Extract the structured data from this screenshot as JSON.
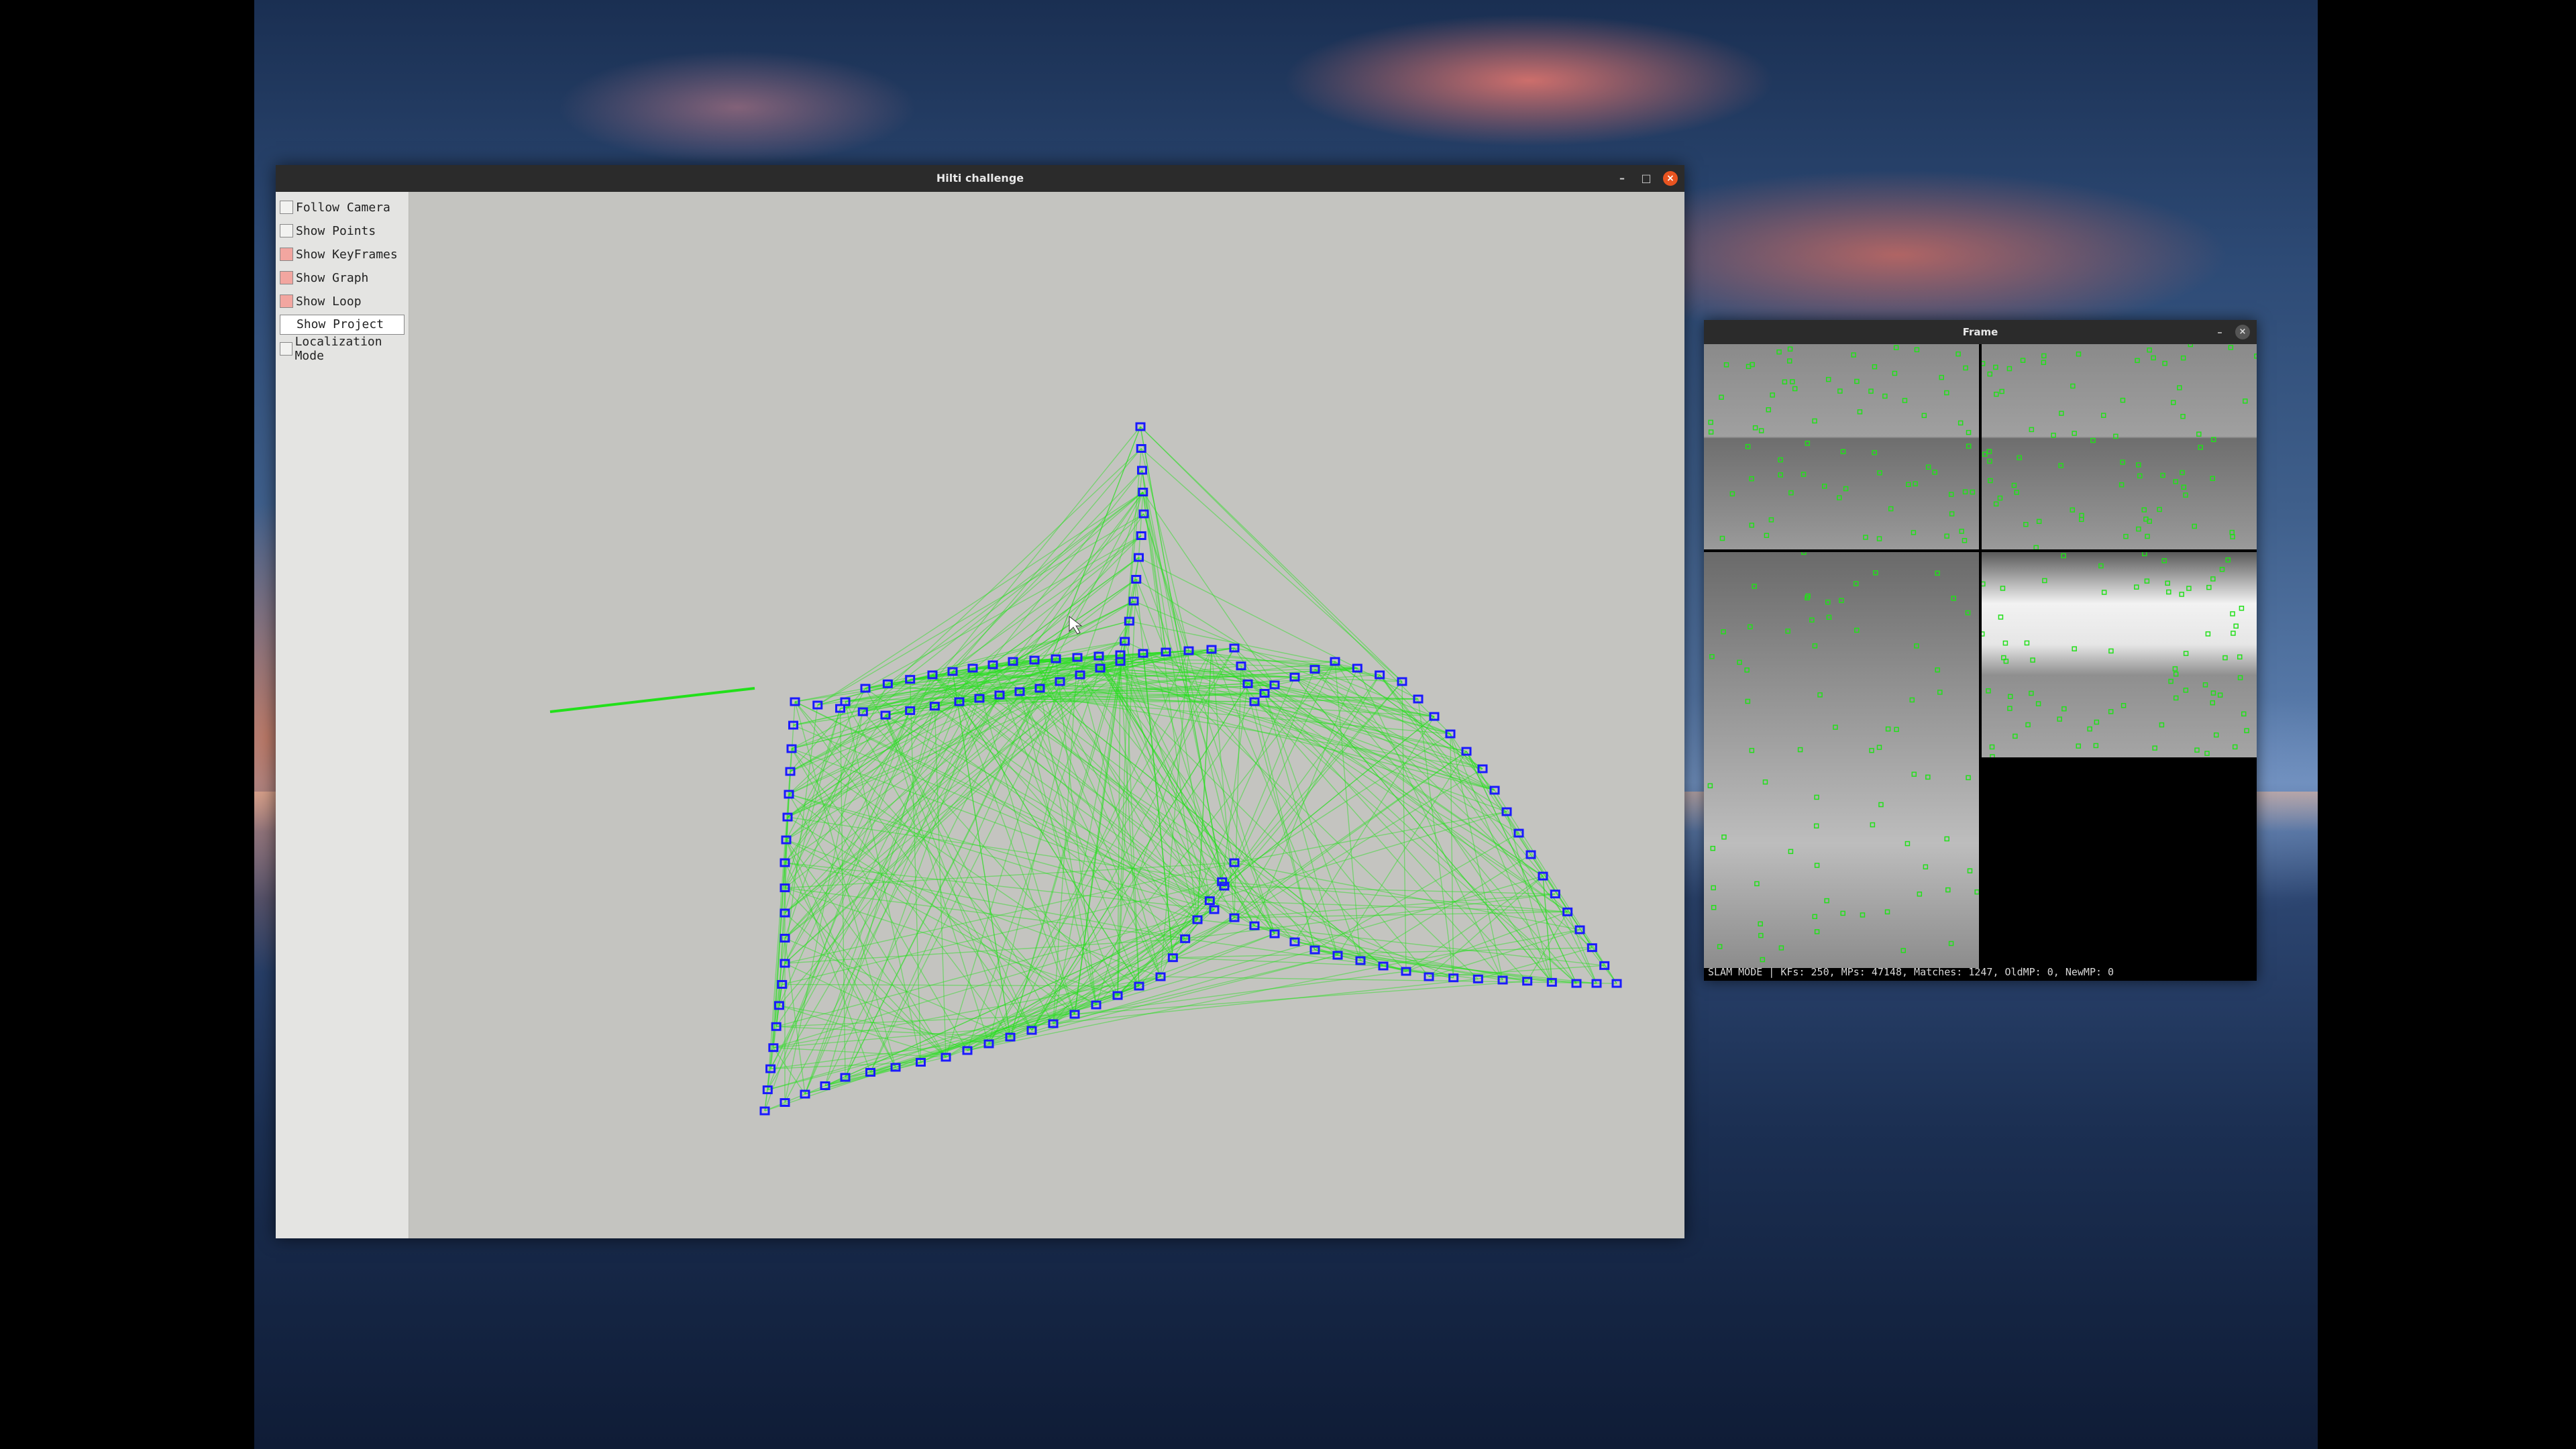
{
  "main_window": {
    "title": "Hilti challenge",
    "controls": {
      "minimize": "–",
      "maximize": "□",
      "close": "×"
    },
    "panel": {
      "items": [
        {
          "label": "Follow Camera",
          "checked": false
        },
        {
          "label": "Show Points",
          "checked": false
        },
        {
          "label": "Show KeyFrames",
          "checked": true
        },
        {
          "label": "Show Graph",
          "checked": true
        },
        {
          "label": "Show Loop",
          "checked": true
        }
      ],
      "project_button": "Show Project",
      "localization": {
        "label": "Localization Mode",
        "checked": false
      }
    },
    "colors": {
      "keyframe": "#1a1aff",
      "graph": "#22e01a",
      "background": "#c4c4c0"
    }
  },
  "frame_window": {
    "title": "Frame",
    "controls": {
      "minimize": "–",
      "close": "×"
    },
    "status": "SLAM MODE |  KFs: 250, MPs: 47148, Matches: 1247, OldMP: 0, NewMP: 0",
    "feature_color": "#22e01a"
  }
}
